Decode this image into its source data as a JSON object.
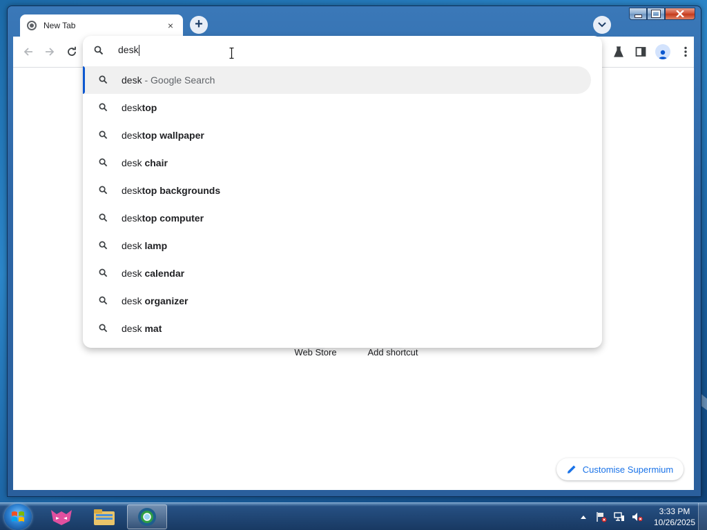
{
  "browser": {
    "tab_title": "New Tab",
    "tab_close": "×",
    "new_tab": "+"
  },
  "omnibox": {
    "query": "desk",
    "suggestions": [
      {
        "prefix": "desk",
        "suffix": " - Google Search",
        "style": "dim"
      },
      {
        "prefix": "desk",
        "suffix": "top",
        "style": "bold"
      },
      {
        "prefix": "desk",
        "suffix": "top wallpaper",
        "style": "bold"
      },
      {
        "prefix": "desk ",
        "suffix": "chair",
        "style": "bold"
      },
      {
        "prefix": "desk",
        "suffix": "top backgrounds",
        "style": "bold"
      },
      {
        "prefix": "desk",
        "suffix": "top computer",
        "style": "bold"
      },
      {
        "prefix": "desk ",
        "suffix": "lamp",
        "style": "bold"
      },
      {
        "prefix": "desk ",
        "suffix": "calendar",
        "style": "bold"
      },
      {
        "prefix": "desk ",
        "suffix": "organizer",
        "style": "bold"
      },
      {
        "prefix": "desk ",
        "suffix": "mat",
        "style": "bold"
      }
    ]
  },
  "new_tab_page": {
    "shortcuts": [
      {
        "label": "Web Store"
      },
      {
        "label": "Add shortcut"
      }
    ],
    "customise_label": "Customise Supermium"
  },
  "taskbar": {
    "clock_time": "3:33 PM",
    "clock_date": "10/26/2025"
  },
  "colors": {
    "accent": "#1a73e8",
    "selection_bar": "#0b57d0"
  }
}
